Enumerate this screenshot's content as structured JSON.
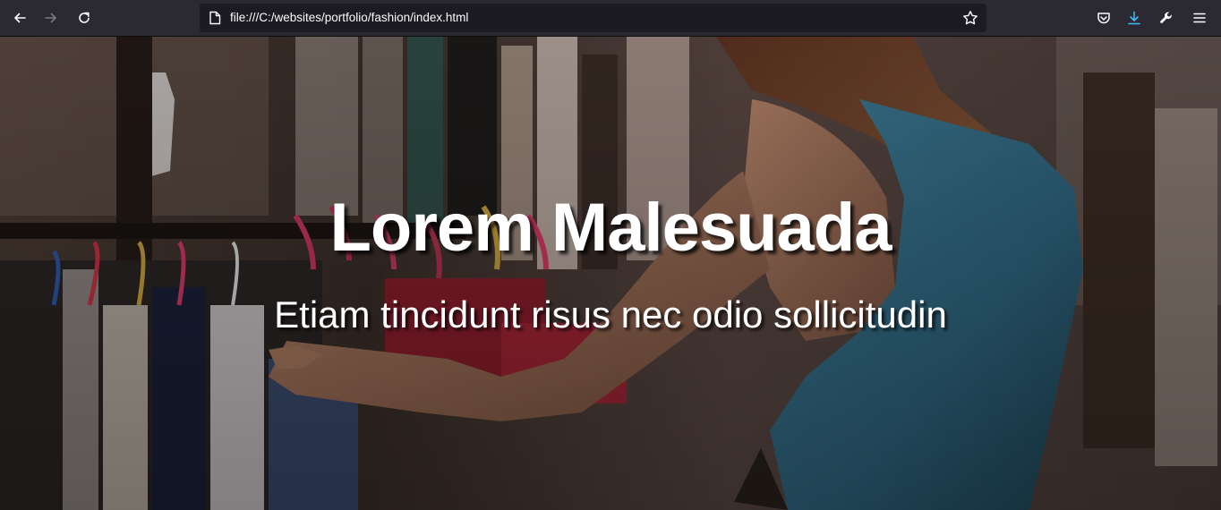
{
  "browser": {
    "url": "file:///C:/websites/portfolio/fashion/index.html",
    "icons": {
      "back": "arrow-left-icon",
      "forward": "arrow-right-icon",
      "reload": "reload-icon",
      "page": "page-icon",
      "bookmark": "star-icon",
      "pocket": "pocket-icon",
      "downloads": "download-icon",
      "customize": "wrench-icon",
      "menu": "hamburger-menu-icon"
    },
    "colors": {
      "toolbar": "#2b2a33",
      "urlbar": "#1c1b22",
      "download_accent": "#3fb8f7"
    }
  },
  "hero": {
    "title": "Lorem Malesuada",
    "subtitle": "Etiam tincidunt risus nec odio sollicitudin"
  }
}
